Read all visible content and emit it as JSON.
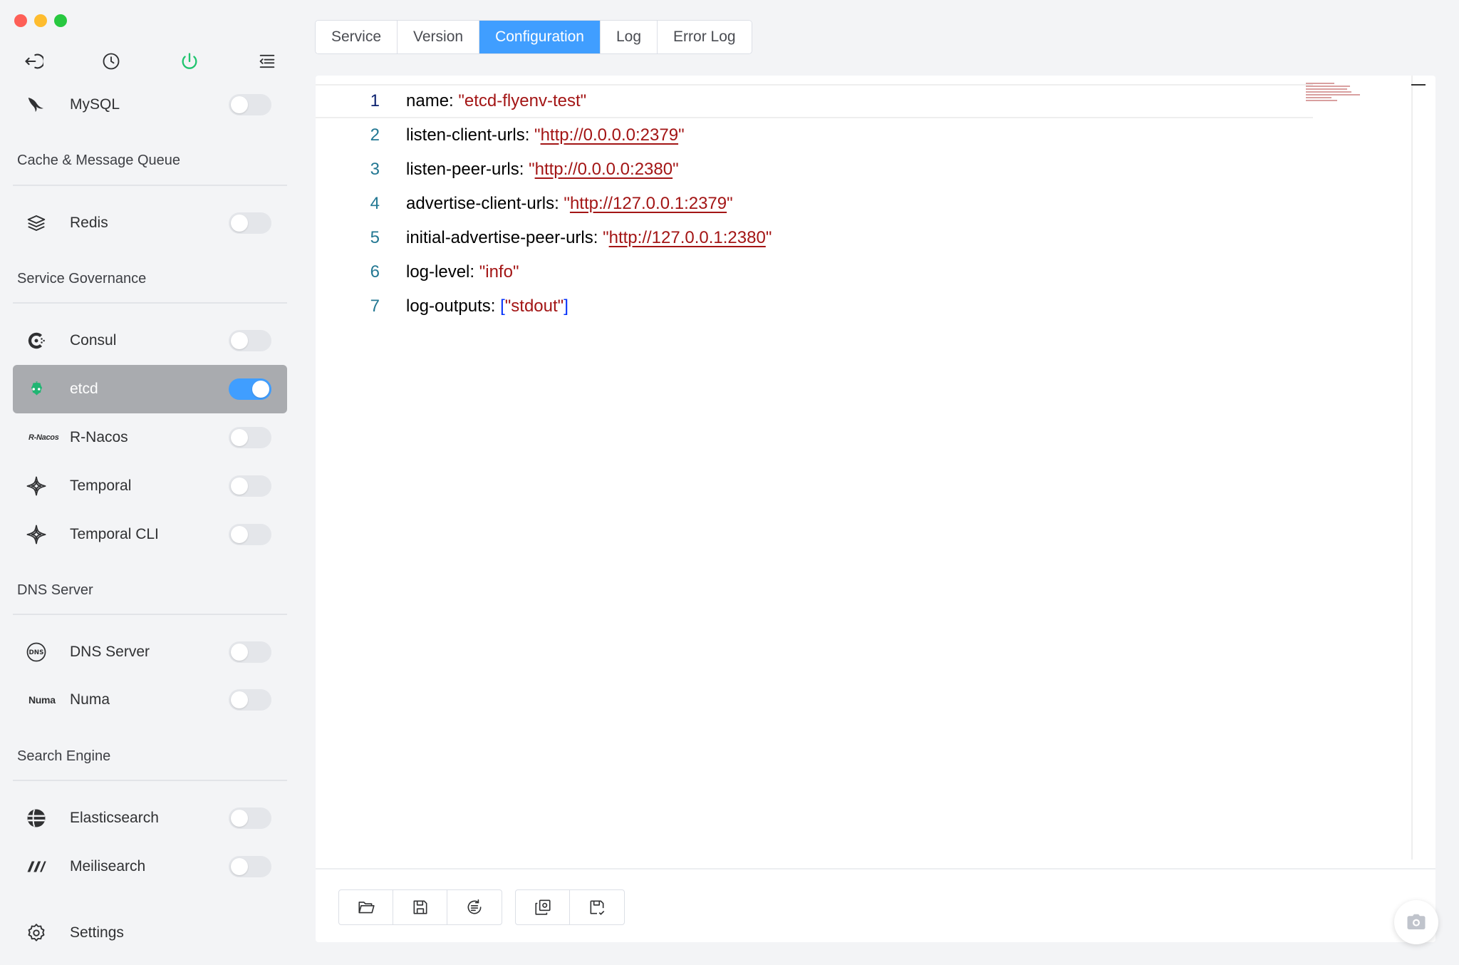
{
  "sidebar": {
    "items": [
      {
        "label": "MySQL",
        "on": false
      },
      {
        "label": "Redis",
        "on": false
      },
      {
        "label": "Consul",
        "on": false
      },
      {
        "label": "etcd",
        "on": true
      },
      {
        "label": "R-Nacos",
        "icon_text": "R-Nacos",
        "on": false
      },
      {
        "label": "Temporal",
        "on": false
      },
      {
        "label": "Temporal CLI",
        "on": false
      },
      {
        "label": "DNS Server",
        "icon_text": "DNS",
        "on": false
      },
      {
        "label": "Numa",
        "icon_text": "Numa",
        "on": false
      },
      {
        "label": "Elasticsearch",
        "on": false
      },
      {
        "label": "Meilisearch",
        "on": false
      }
    ],
    "groups": {
      "cache": "Cache & Message Queue",
      "governance": "Service Governance",
      "dns": "DNS Server",
      "search": "Search Engine"
    },
    "settings_label": "Settings",
    "icons": [
      "back-icon",
      "clock-icon",
      "power-icon",
      "menu-fold-icon"
    ]
  },
  "tabs": [
    {
      "label": "Service",
      "active": false
    },
    {
      "label": "Version",
      "active": false
    },
    {
      "label": "Configuration",
      "active": true
    },
    {
      "label": "Log",
      "active": false
    },
    {
      "label": "Error Log",
      "active": false
    }
  ],
  "editor": {
    "lines": [
      {
        "num": "1",
        "key": "name: ",
        "q1": "\"",
        "value": "etcd-flyenv-test",
        "q2": "\""
      },
      {
        "num": "2",
        "key": "listen-client-urls: ",
        "q1": "\"",
        "value": "http://0.0.0.0:2379",
        "q2": "\""
      },
      {
        "num": "3",
        "key": "listen-peer-urls: ",
        "q1": "\"",
        "value": "http://0.0.0.0:2380",
        "q2": "\""
      },
      {
        "num": "4",
        "key": "advertise-client-urls: ",
        "q1": "\"",
        "value": "http://127.0.0.1:2379",
        "q2": "\""
      },
      {
        "num": "5",
        "key": "initial-advertise-peer-urls: ",
        "q1": "\"",
        "value": "http://127.0.0.1:2380",
        "q2": "\""
      },
      {
        "num": "6",
        "key": "log-level: ",
        "q1": "\"",
        "value": "info",
        "q2": "\""
      },
      {
        "num": "7",
        "key": "log-outputs: ",
        "b1": "[",
        "value": "\"stdout\"",
        "b2": "]"
      }
    ]
  },
  "colors": {
    "accent": "#409eff",
    "string": "#a31515",
    "line_number": "#237893",
    "bracket": "#0431fa",
    "etcd_green": "#21b573",
    "power_green": "#1fc46e"
  },
  "toolbar": {
    "group1": [
      "folder-open-icon",
      "save-icon",
      "format-icon"
    ],
    "group2": [
      "load-default-icon",
      "save-custom-icon"
    ]
  }
}
